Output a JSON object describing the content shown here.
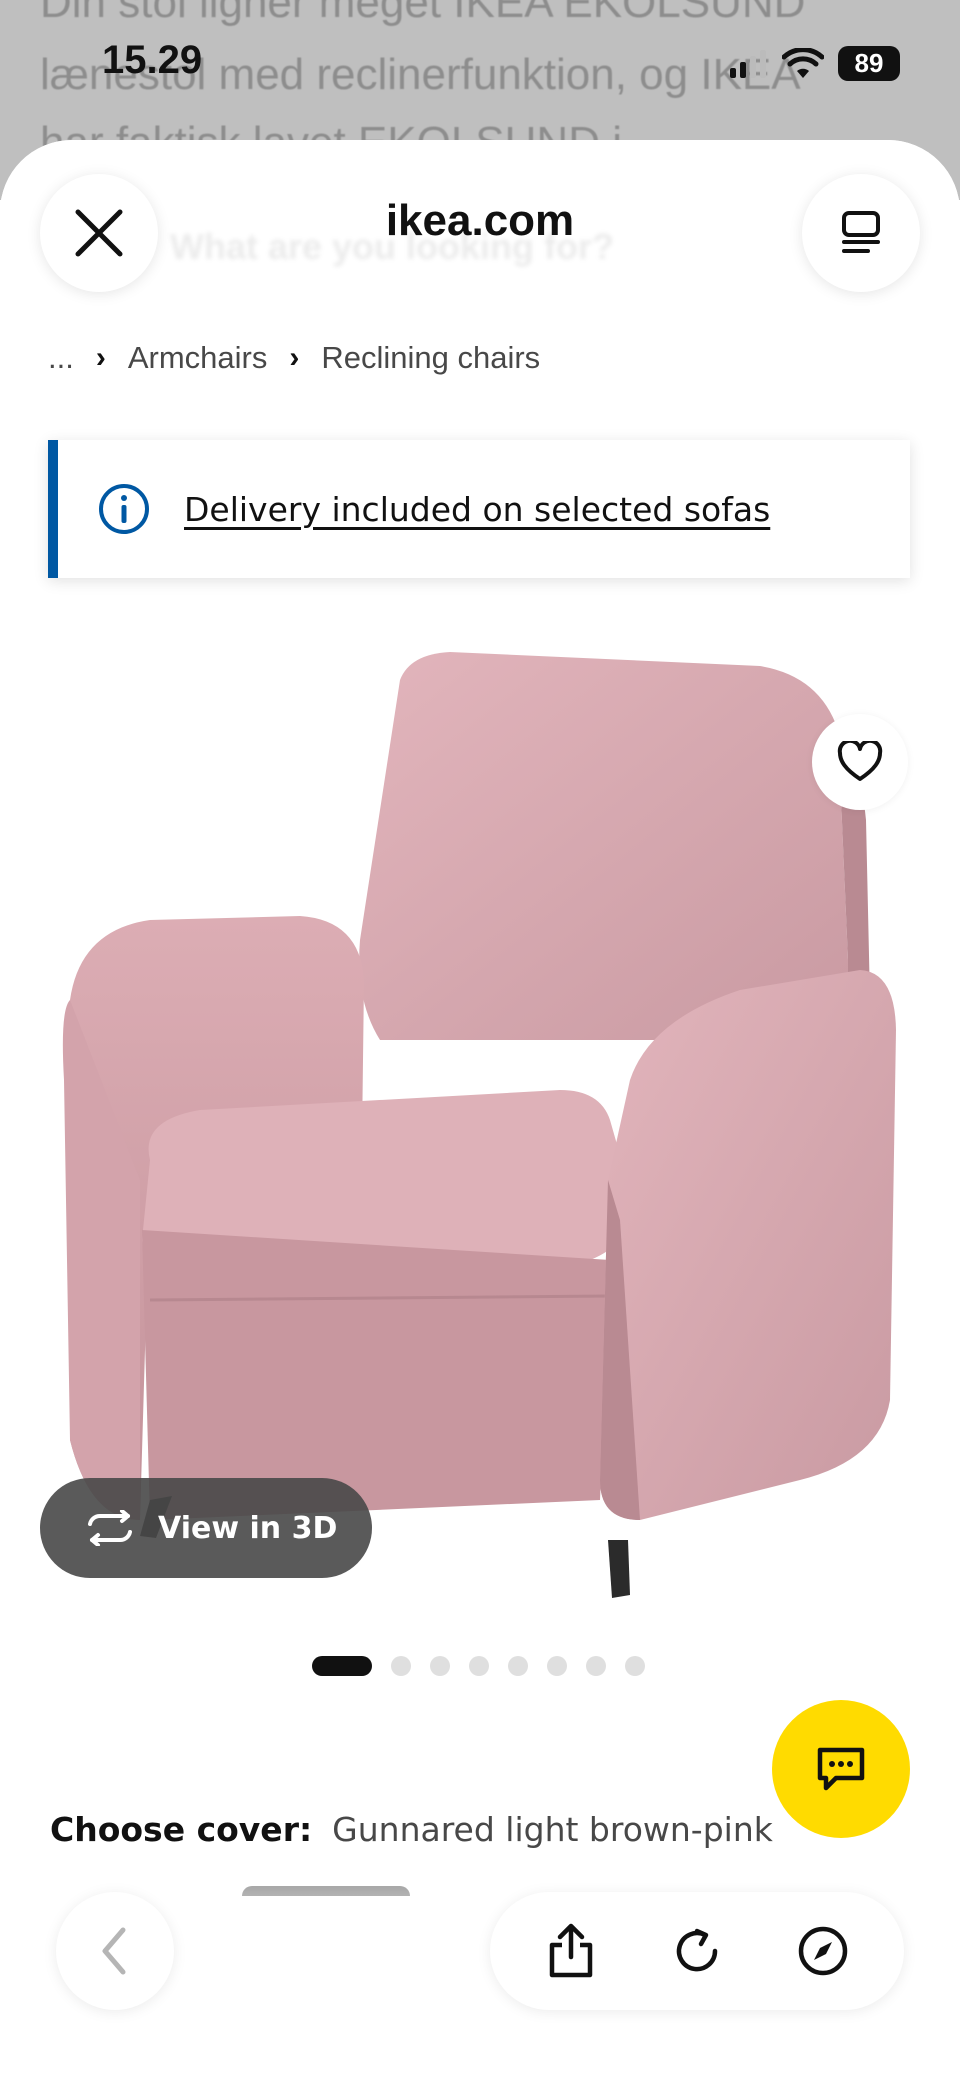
{
  "status_bar": {
    "time": "15.29",
    "battery": "89"
  },
  "background_page": {
    "line1": "Din stol ligner meget IKEA EKOLSUND",
    "line2": "lænestol med reclinerfunktion, og IKEA",
    "line3": "har faktisk lavet EKOLSUND i"
  },
  "browser": {
    "url": "ikea.com",
    "search_placeholder": "What are you looking for?"
  },
  "breadcrumb": {
    "items": [
      "...",
      "Armchairs",
      "Reclining chairs"
    ]
  },
  "banner": {
    "text": "Delivery included on selected sofas"
  },
  "product": {
    "view3d_label": "View in 3D",
    "carousel": {
      "count": 8,
      "active_index": 0
    },
    "cover_label": "Choose cover:",
    "cover_value": "Gunnared light brown-pink"
  },
  "colors": {
    "ikea_blue": "#0058a3",
    "ikea_yellow": "#ffdb00",
    "chair_pink": "#d9a8b0"
  },
  "icons": {
    "close": "close-icon",
    "tabs": "tabs-icon",
    "info": "info-icon",
    "favourite": "heart-icon",
    "view3d": "rotate-3d-icon",
    "chat": "chat-icon",
    "back": "chevron-left-icon",
    "share": "share-icon",
    "reload": "reload-icon",
    "explore": "compass-icon"
  }
}
